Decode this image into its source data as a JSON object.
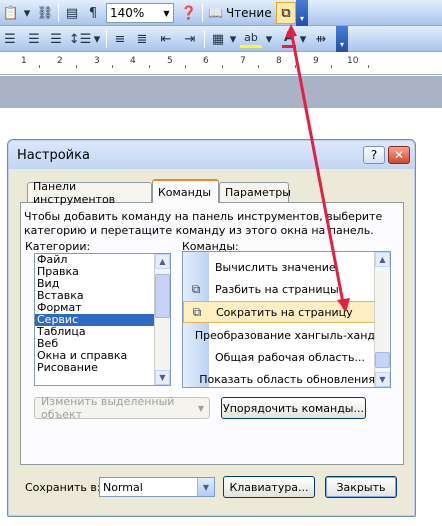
{
  "toolbar": {
    "zoom_value": "140%",
    "reading_label": "Чтение",
    "paragraph_mark": "¶",
    "font_color_letter": "A",
    "highlight_letters": "ab"
  },
  "ruler": {
    "numbers": [
      "1",
      "2",
      "3",
      "4",
      "5",
      "6",
      "7",
      "8",
      "9",
      "10"
    ]
  },
  "dialog": {
    "title": "Настройка",
    "help_button": "?",
    "close_button": "✕",
    "tabs": [
      "Панели инструментов",
      "Команды",
      "Параметры"
    ],
    "active_tab": "Команды",
    "description": "Чтобы добавить команду на панель инструментов, выберите категорию и перетащите команду из этого окна на панель.",
    "categories_label": "Категории:",
    "commands_label": "Команды:",
    "categories": [
      "Файл",
      "Правка",
      "Вид",
      "Вставка",
      "Формат",
      "Сервис",
      "Таблица",
      "Веб",
      "Окна и справка",
      "Рисование"
    ],
    "selected_category": "Сервис",
    "commands": [
      {
        "label": "Вычислить значение",
        "icon": ""
      },
      {
        "label": "Разбить на страницы",
        "icon": "split-pages-icon"
      },
      {
        "label": "Сократить на страницу",
        "icon": "shrink-one-page-icon"
      },
      {
        "label": "Преобразование хангыль-ханд",
        "icon": ""
      },
      {
        "label": "Общая рабочая область...",
        "icon": ""
      },
      {
        "label": "Показать область обновления",
        "icon": ""
      }
    ],
    "selected_command": "Сократить на страницу",
    "modify_selection_label": "Изменить выделенный объект",
    "rearrange_commands_label": "Упорядочить команды...",
    "save_in_label": "Сохранить в:",
    "save_in_value": "Normal",
    "keyboard_label": "Клавиатура...",
    "close_label": "Закрыть"
  },
  "colors": {
    "annotation_arrow": "#e32040",
    "selection": "#316ac5",
    "toolbar_blue": "#c3d8f4"
  }
}
